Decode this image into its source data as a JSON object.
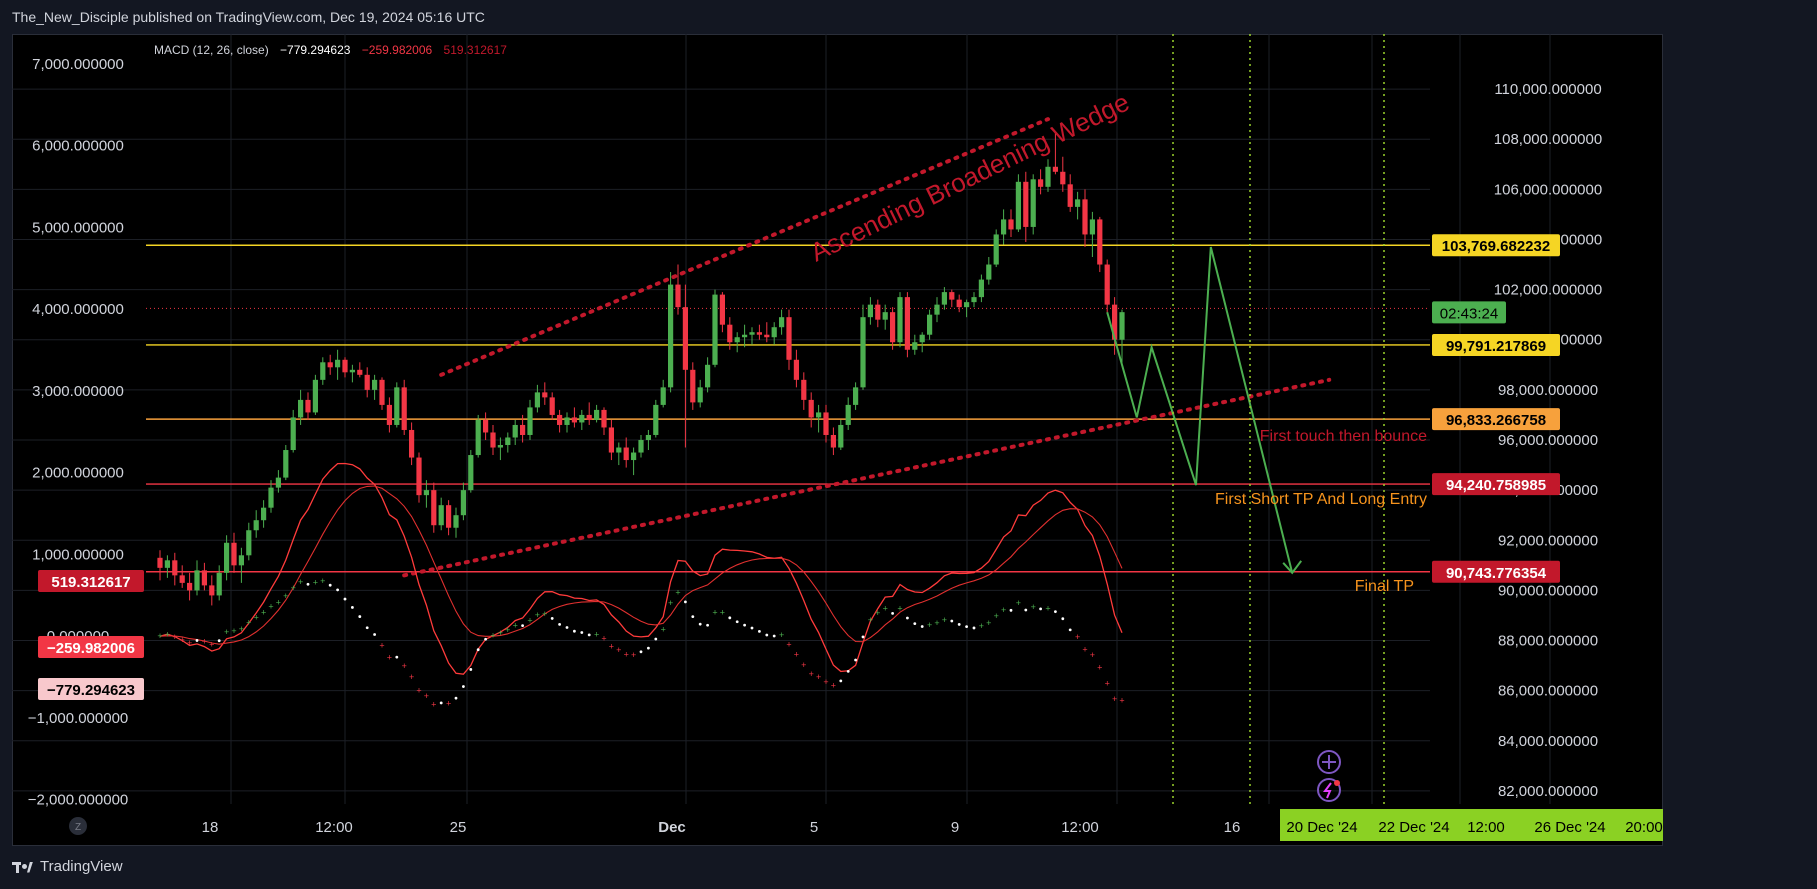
{
  "header": {
    "publisher_line": "The_New_Disciple published on TradingView.com, Dec 19, 2024 05:16 UTC"
  },
  "footer": {
    "brand": "TradingView"
  },
  "indicator": {
    "legend_name": "MACD (12, 26, close)",
    "legend_macd": "−779.294623",
    "legend_signal": "−259.982006",
    "legend_hist": "519.312617"
  },
  "annotations": {
    "wedge_label": "Ascending Broadening Wedge",
    "label_bounce": "First touch then bounce",
    "label_short_tp": "First Short TP And Long Entry",
    "label_final_tp": "Final TP"
  },
  "axis_buttons": {
    "left": "Z",
    "right": "A"
  },
  "colors": {
    "background": "#000000",
    "frame": "#131722",
    "bull": "#4caf50",
    "bear": "#f23645",
    "yellow_line": "#f5d524",
    "orange_line": "#f7a13c",
    "red_line": "#f23645",
    "annotation_red": "#c2182b",
    "annotation_orange": "#f7941d",
    "projection_green": "#4caf50"
  },
  "chart_data": {
    "type": "candlestick",
    "symbol_price_range": [
      81000,
      111000
    ],
    "right_axis_ticks": [
      "110,000.000000",
      "108,000.000000",
      "106,000.000000",
      "104,000.000000",
      "102,000.000000",
      "100,000.000000",
      "98,000.000000",
      "96,000.000000",
      "94,000.000000",
      "92,000.000000",
      "90,000.000000",
      "88,000.000000",
      "86,000.000000",
      "84,000.000000",
      "82,000.000000"
    ],
    "right_axis_values": [
      110000,
      108000,
      106000,
      104000,
      102000,
      100000,
      98000,
      96000,
      94000,
      92000,
      90000,
      88000,
      86000,
      84000,
      82000
    ],
    "left_axis_ticks": [
      "7,000.000000",
      "6,000.000000",
      "5,000.000000",
      "4,000.000000",
      "3,000.000000",
      "2,000.000000",
      "1,000.000000",
      "0.000000",
      "−1,000.000000",
      "−2,000.000000"
    ],
    "left_axis_values": [
      7000,
      6000,
      5000,
      4000,
      3000,
      2000,
      1000,
      0,
      -1000,
      -2000
    ],
    "macd_range": [
      -2200,
      7000
    ],
    "x_ticks": [
      "18",
      "12:00",
      "25",
      "Dec",
      "5",
      "9",
      "12:00",
      "16"
    ],
    "x_tick_bold": [
      false,
      false,
      false,
      true,
      false,
      false,
      false,
      false
    ],
    "future_ticks": [
      "20 Dec '24",
      "22 Dec '24",
      "12:00",
      "26 Dec '24",
      "20:00"
    ],
    "horizontal_levels": [
      {
        "price": 103769.682232,
        "label": "103,769.682232",
        "style": "yellow"
      },
      {
        "price": 99791.217869,
        "label": "99,791.217869",
        "style": "yellow"
      },
      {
        "price": 96833.266758,
        "label": "96,833.266758",
        "style": "orange"
      },
      {
        "price": 94240.758985,
        "label": "94,240.758985",
        "style": "red"
      },
      {
        "price": 90743.776354,
        "label": "90,743.776354",
        "style": "red"
      }
    ],
    "current_price_dotted": 101250,
    "countdown_label": "02:43:24",
    "macd_tags": [
      {
        "value": 519.312617,
        "label": "519.312617",
        "style": "hist"
      },
      {
        "value": -259.982006,
        "label": "−259.982006",
        "style": "signal"
      },
      {
        "value": -779.294623,
        "label": "−779.294623",
        "style": "macd"
      }
    ],
    "candles": [
      [
        91300,
        91600,
        90400,
        90900
      ],
      [
        90900,
        91400,
        90500,
        91200
      ],
      [
        91200,
        91500,
        90200,
        90600
      ],
      [
        90600,
        91000,
        90100,
        90300
      ],
      [
        90300,
        90700,
        89600,
        90000
      ],
      [
        90000,
        91200,
        89800,
        90800
      ],
      [
        90800,
        91100,
        90000,
        90200
      ],
      [
        90200,
        90600,
        89400,
        89800
      ],
      [
        89800,
        91000,
        89600,
        90700
      ],
      [
        90700,
        92200,
        90400,
        91900
      ],
      [
        91900,
        92300,
        90700,
        91000
      ],
      [
        91000,
        91700,
        90300,
        91400
      ],
      [
        91400,
        92700,
        91200,
        92400
      ],
      [
        92400,
        93200,
        92100,
        92800
      ],
      [
        92800,
        93600,
        92500,
        93300
      ],
      [
        93300,
        94400,
        93100,
        94100
      ],
      [
        94100,
        94800,
        93900,
        94500
      ],
      [
        94500,
        95800,
        94400,
        95600
      ],
      [
        95600,
        97200,
        95500,
        96900
      ],
      [
        96900,
        98000,
        96600,
        97600
      ],
      [
        97600,
        97900,
        96800,
        97100
      ],
      [
        97100,
        98600,
        97000,
        98400
      ],
      [
        98400,
        99300,
        98200,
        99100
      ],
      [
        99100,
        99400,
        98600,
        98900
      ],
      [
        98900,
        99600,
        98400,
        99200
      ],
      [
        99200,
        99300,
        98500,
        98700
      ],
      [
        98700,
        99000,
        98300,
        98800
      ],
      [
        98800,
        99100,
        98500,
        98600
      ],
      [
        98600,
        98900,
        97700,
        98000
      ],
      [
        98000,
        98600,
        97600,
        98400
      ],
      [
        98400,
        98500,
        97200,
        97400
      ],
      [
        97400,
        97700,
        96300,
        96600
      ],
      [
        96600,
        98300,
        96500,
        98100
      ],
      [
        98100,
        98400,
        96200,
        96400
      ],
      [
        96400,
        96700,
        95000,
        95300
      ],
      [
        95300,
        95500,
        93500,
        93800
      ],
      [
        93800,
        94400,
        93300,
        94000
      ],
      [
        94000,
        94300,
        92300,
        92600
      ],
      [
        92600,
        93700,
        92400,
        93400
      ],
      [
        93400,
        93600,
        92200,
        92500
      ],
      [
        92500,
        93300,
        92100,
        93000
      ],
      [
        93000,
        94300,
        92800,
        94000
      ],
      [
        94000,
        95600,
        93900,
        95400
      ],
      [
        95400,
        97000,
        95300,
        96800
      ],
      [
        96800,
        97100,
        96000,
        96300
      ],
      [
        96300,
        96600,
        95400,
        95700
      ],
      [
        95700,
        96100,
        95200,
        95800
      ],
      [
        95800,
        96300,
        95500,
        96100
      ],
      [
        96100,
        96800,
        95800,
        96600
      ],
      [
        96600,
        97000,
        95900,
        96200
      ],
      [
        96200,
        97600,
        96000,
        97300
      ],
      [
        97300,
        98200,
        97100,
        97900
      ],
      [
        97900,
        98300,
        97400,
        97700
      ],
      [
        97700,
        97900,
        96800,
        97000
      ],
      [
        97000,
        97200,
        96300,
        96600
      ],
      [
        96600,
        97100,
        96300,
        96900
      ],
      [
        96900,
        97300,
        96500,
        96700
      ],
      [
        96700,
        97200,
        96400,
        97000
      ],
      [
        97000,
        97500,
        96600,
        96800
      ],
      [
        96800,
        97400,
        96700,
        97200
      ],
      [
        97200,
        97300,
        96200,
        96500
      ],
      [
        96500,
        96800,
        95200,
        95500
      ],
      [
        95500,
        95900,
        95000,
        95700
      ],
      [
        95700,
        96100,
        94900,
        95200
      ],
      [
        95200,
        95700,
        94600,
        95500
      ],
      [
        95500,
        96200,
        95300,
        96000
      ],
      [
        96000,
        96400,
        95600,
        96200
      ],
      [
        96200,
        97600,
        96100,
        97400
      ],
      [
        97400,
        98400,
        97300,
        98100
      ],
      [
        98100,
        102700,
        97900,
        102200
      ],
      [
        102200,
        103000,
        101000,
        101300
      ],
      [
        101300,
        102200,
        95700,
        98800
      ],
      [
        98800,
        99100,
        97200,
        97500
      ],
      [
        97500,
        98400,
        97300,
        98100
      ],
      [
        98100,
        99300,
        97900,
        99000
      ],
      [
        99000,
        102000,
        98900,
        101800
      ],
      [
        101800,
        101900,
        100300,
        100600
      ],
      [
        100600,
        100900,
        99600,
        99900
      ],
      [
        99900,
        100300,
        99500,
        100100
      ],
      [
        100100,
        100600,
        99700,
        100200
      ],
      [
        100200,
        100500,
        99800,
        100300
      ],
      [
        100300,
        100600,
        100000,
        100200
      ],
      [
        100200,
        100700,
        99900,
        100100
      ],
      [
        100100,
        100700,
        99800,
        100500
      ],
      [
        100500,
        101200,
        100200,
        100900
      ],
      [
        100900,
        101200,
        98800,
        99200
      ],
      [
        99200,
        99600,
        98100,
        98400
      ],
      [
        98400,
        98700,
        97200,
        97600
      ],
      [
        97600,
        97900,
        96500,
        96900
      ],
      [
        96900,
        97400,
        96300,
        97100
      ],
      [
        97100,
        97400,
        95900,
        96200
      ],
      [
        96200,
        96500,
        95400,
        95700
      ],
      [
        95700,
        96800,
        95600,
        96600
      ],
      [
        96600,
        97700,
        96400,
        97400
      ],
      [
        97400,
        98300,
        97200,
        98100
      ],
      [
        98100,
        101400,
        98000,
        100900
      ],
      [
        100900,
        101700,
        100600,
        101400
      ],
      [
        101400,
        101600,
        100500,
        100800
      ],
      [
        100800,
        101400,
        100400,
        101100
      ],
      [
        101100,
        101300,
        99600,
        99900
      ],
      [
        99900,
        101900,
        99700,
        101700
      ],
      [
        101700,
        101900,
        99300,
        99600
      ],
      [
        99600,
        100200,
        99400,
        99900
      ],
      [
        99900,
        100300,
        99500,
        100200
      ],
      [
        100200,
        101200,
        100000,
        101000
      ],
      [
        101000,
        101700,
        100700,
        101400
      ],
      [
        101400,
        102100,
        101200,
        101900
      ],
      [
        101900,
        102000,
        101300,
        101600
      ],
      [
        101600,
        101800,
        101100,
        101300
      ],
      [
        101300,
        101600,
        100900,
        101500
      ],
      [
        101500,
        101900,
        101300,
        101700
      ],
      [
        101700,
        102600,
        101500,
        102400
      ],
      [
        102400,
        103300,
        102200,
        103000
      ],
      [
        103000,
        104400,
        102900,
        104200
      ],
      [
        104200,
        105200,
        103800,
        104800
      ],
      [
        104800,
        105200,
        104100,
        104400
      ],
      [
        104400,
        106600,
        104300,
        106300
      ],
      [
        106300,
        106700,
        103900,
        104500
      ],
      [
        104500,
        106600,
        104200,
        106400
      ],
      [
        106400,
        106800,
        105800,
        106100
      ],
      [
        106100,
        107200,
        105900,
        106900
      ],
      [
        106900,
        108300,
        106600,
        106700
      ],
      [
        106700,
        107300,
        105900,
        106200
      ],
      [
        106200,
        106600,
        105100,
        105300
      ],
      [
        105300,
        105900,
        104800,
        105600
      ],
      [
        105600,
        106000,
        103700,
        104200
      ],
      [
        104200,
        105100,
        103300,
        104800
      ],
      [
        104800,
        104900,
        102700,
        103000
      ],
      [
        103000,
        103200,
        101100,
        101400
      ],
      [
        101400,
        101700,
        99400,
        100000
      ],
      [
        100000,
        101200,
        99000,
        101100
      ]
    ],
    "wedge_upper": {
      "from": [
        38,
        98600
      ],
      "to": [
        120,
        108800
      ]
    },
    "wedge_lower": {
      "from": [
        33,
        90600
      ],
      "to": [
        158,
        98400
      ]
    },
    "projection_path": [
      [
        128,
        101100
      ],
      [
        132,
        96900
      ],
      [
        134,
        99700
      ],
      [
        140,
        94200
      ],
      [
        142,
        103700
      ],
      [
        153,
        90700
      ]
    ],
    "future_x_index": [
      132.7,
      140,
      142.8,
      148.1,
      152
    ]
  }
}
